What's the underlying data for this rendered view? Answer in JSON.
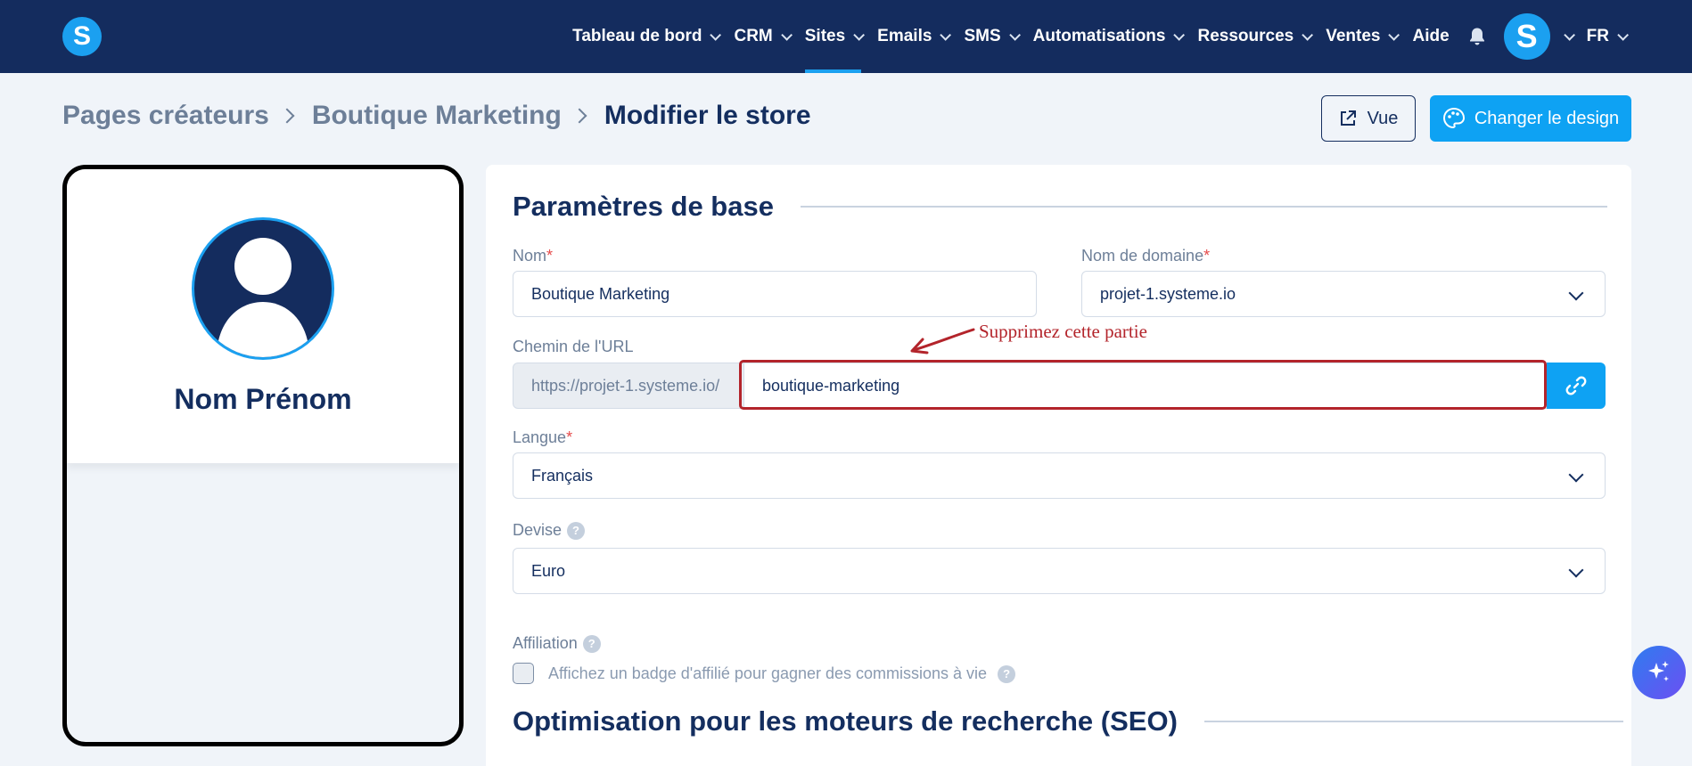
{
  "nav": {
    "items": [
      {
        "label": "Tableau de bord",
        "chevron": true,
        "active": false
      },
      {
        "label": "CRM",
        "chevron": true,
        "active": false
      },
      {
        "label": "Sites",
        "chevron": true,
        "active": true
      },
      {
        "label": "Emails",
        "chevron": true,
        "active": false
      },
      {
        "label": "SMS",
        "chevron": true,
        "active": false
      },
      {
        "label": "Automatisations",
        "chevron": true,
        "active": false
      },
      {
        "label": "Ressources",
        "chevron": true,
        "active": false
      },
      {
        "label": "Ventes",
        "chevron": true,
        "active": false
      },
      {
        "label": "Aide",
        "chevron": false,
        "active": false
      }
    ],
    "logo_letter": "S",
    "avatar_letter": "S",
    "language": "FR"
  },
  "breadcrumb": {
    "items": [
      "Pages créateurs",
      "Boutique Marketing"
    ],
    "current": "Modifier le store"
  },
  "actions": {
    "view_label": "Vue",
    "design_label": "Changer le design"
  },
  "preview": {
    "name": "Nom Prénom"
  },
  "form": {
    "section_basic": "Paramètres de base",
    "name_label": "Nom",
    "name_value": "Boutique Marketing",
    "domain_label": "Nom de domaine",
    "domain_value": "projet-1.systeme.io",
    "url_label": "Chemin de l'URL",
    "url_prefix": "https://projet-1.systeme.io/",
    "url_path": "boutique-marketing",
    "language_label": "Langue",
    "language_value": "Français",
    "currency_label": "Devise",
    "currency_value": "Euro",
    "affiliation_label": "Affiliation",
    "affiliation_checkbox_label": "Affichez un badge d'affilié pour gagner des commissions à vie",
    "affiliation_checked": false,
    "section_seo": "Optimisation pour les moteurs de recherche (SEO)",
    "required_mark": "*",
    "help_mark": "?"
  },
  "annotation": {
    "text": "Supprimez cette partie",
    "color": "#b3242b"
  },
  "colors": {
    "nav_bg": "#142c5e",
    "accent": "#0ea2f3",
    "page_bg": "#f0f4f9",
    "text_dark": "#142e5f"
  }
}
